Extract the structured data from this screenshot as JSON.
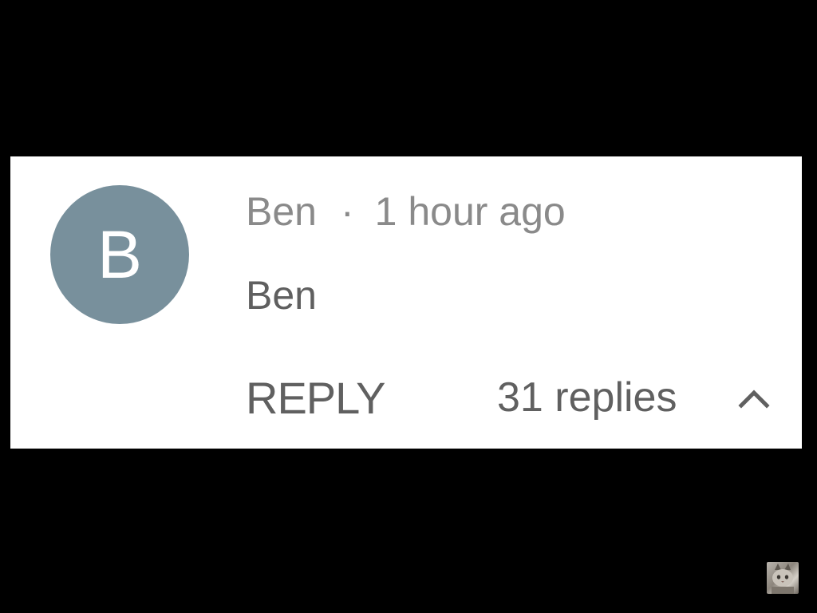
{
  "comment": {
    "avatar_letter": "B",
    "avatar_color": "#78909c",
    "author": "Ben",
    "separator": "·",
    "timestamp": "1 hour ago",
    "text": "Ben",
    "reply_label": "REPLY",
    "replies_label": "31 replies",
    "toggle_icon": "chevron-up-icon"
  },
  "colors": {
    "background": "#000000",
    "card": "#ffffff",
    "meta_text": "#8a8a8a",
    "body_text": "#5f5f5f"
  },
  "corner_image": {
    "icon": "cat-thumbnail"
  }
}
